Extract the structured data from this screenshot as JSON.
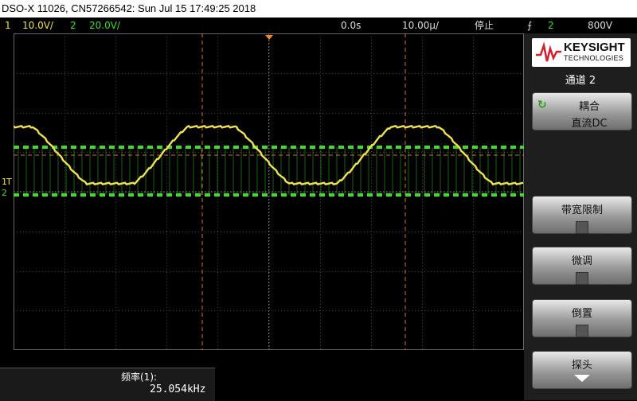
{
  "title": "DSO-X 11026, CN57266542: Sun Jul 15 17:49:25 2018",
  "status": {
    "ch1_num": "1",
    "ch1_scale": "10.0V/",
    "ch2_num": "2",
    "ch2_scale": "20.0V/",
    "time_offset": "0.0s",
    "time_scale": "10.00µ/",
    "run_state": "停止",
    "trigger_icon": "rising-edge-icon",
    "trigger_src": "2",
    "trigger_level": "800V"
  },
  "markers": {
    "ch1": "1",
    "ch2": "2",
    "trigger": "T"
  },
  "colors": {
    "ch1": "#f0e24a",
    "ch2": "#3fdc2a",
    "cursor": "#e07020"
  },
  "measurement": {
    "label": "频率(1):",
    "value": "25.054kHz"
  },
  "panel": {
    "brand": "KEYSIGHT",
    "brand_sub": "TECHNOLOGIES",
    "channel_title": "通道 2",
    "coupling_label": "耦合",
    "coupling_value": "直流DC",
    "bandwidth_label": "带宽限制",
    "bandwidth_checked": false,
    "fine_label": "微调",
    "fine_checked": false,
    "invert_label": "倒置",
    "invert_checked": false,
    "probe_label": "探头"
  }
}
